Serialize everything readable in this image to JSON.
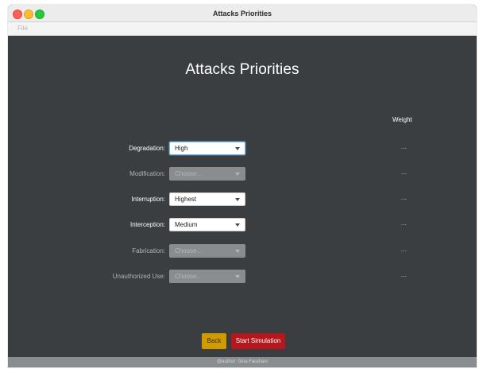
{
  "window": {
    "title": "Attacks Priorities"
  },
  "menubar": {
    "file": "File"
  },
  "page": {
    "title": "Attacks Priorities",
    "weight_header": "Weight"
  },
  "rows": [
    {
      "label": "Degradation:",
      "value": "High",
      "enabled": true,
      "focused": true,
      "weight": "..."
    },
    {
      "label": "Modification:",
      "value": "Choose...",
      "enabled": false,
      "focused": false,
      "weight": "..."
    },
    {
      "label": "Interruption:",
      "value": "Highest",
      "enabled": true,
      "focused": false,
      "weight": "..."
    },
    {
      "label": "Interception:",
      "value": "Medium",
      "enabled": true,
      "focused": false,
      "weight": "..."
    },
    {
      "label": "Fabrication:",
      "value": "Choose...",
      "enabled": false,
      "focused": false,
      "weight": "..."
    },
    {
      "label": "Unauthorized Use:",
      "value": "Choose...",
      "enabled": false,
      "focused": false,
      "weight": "..."
    }
  ],
  "buttons": {
    "back": "Back",
    "start": "Start Simulation"
  },
  "footer": {
    "author": "@author: Sina Farahani"
  },
  "colors": {
    "background": "#3a3e40",
    "back_button": "#d19b00",
    "start_button": "#b5171d",
    "focus_ring": "#6fb6e8"
  }
}
